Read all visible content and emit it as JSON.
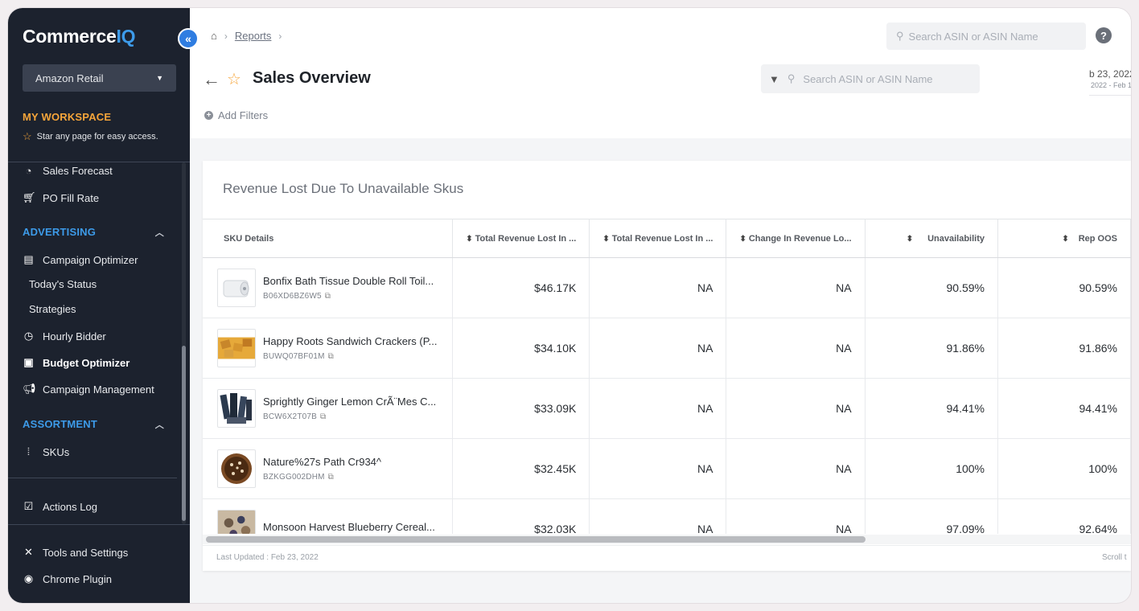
{
  "sidebar": {
    "logo": {
      "part1": "Commerce",
      "part2": "IQ"
    },
    "collapse_icon": "double-chevron-left-icon",
    "retailer": "Amazon Retail",
    "workspace": {
      "title": "MY WORKSPACE",
      "hint": "Star any page for easy access."
    },
    "items_top": [
      {
        "label": "Sales Forecast",
        "icon": "forecast-icon"
      },
      {
        "label": "PO Fill Rate",
        "icon": "cart-icon"
      }
    ],
    "advertising": {
      "title": "ADVERTISING",
      "items": [
        {
          "label": "Campaign Optimizer"
        },
        {
          "label": "Today's Status"
        },
        {
          "label": "Strategies"
        },
        {
          "label": "Hourly Bidder"
        },
        {
          "label": "Budget Optimizer"
        },
        {
          "label": "Campaign Management"
        }
      ]
    },
    "assortment": {
      "title": "ASSORTMENT",
      "items": [
        {
          "label": "SKUs"
        }
      ]
    },
    "actions_log": "Actions Log",
    "tools": "Tools and Settings",
    "chrome": "Chrome Plugin"
  },
  "header": {
    "breadcrumb": {
      "current": "Reports"
    },
    "top_search_placeholder": "Search ASIN or ASIN Name",
    "help": "?",
    "title": "Sales Overview",
    "filter_search_placeholder": "Search ASIN or ASIN Name",
    "date_range": {
      "line1": "b 23, 2022",
      "line2": "2022 - Feb 1"
    },
    "add_filters": "Add Filters"
  },
  "card": {
    "title": "Revenue Lost Due To Unavailable Skus",
    "columns": [
      "SKU Details",
      "Total Revenue Lost In ...",
      "Total Revenue Lost In ...",
      "Change In Revenue Lo...",
      "Unavailability",
      "Rep OOS"
    ],
    "rows": [
      {
        "name": "Bonfix Bath Tissue Double Roll Toil...",
        "id": "B06XD6BZ6W5",
        "c1": "$46.17K",
        "c2": "NA",
        "c3": "NA",
        "c4": "90.59%",
        "c5": "90.59%"
      },
      {
        "name": "Happy Roots Sandwich Crackers (P...",
        "id": "BUWQ07BF01M",
        "c1": "$34.10K",
        "c2": "NA",
        "c3": "NA",
        "c4": "91.86%",
        "c5": "91.86%"
      },
      {
        "name": "Sprightly Ginger Lemon CrÃ¨Mes C...",
        "id": "BCW6X2T07B",
        "c1": "$33.09K",
        "c2": "NA",
        "c3": "NA",
        "c4": "94.41%",
        "c5": "94.41%"
      },
      {
        "name": "Nature%27s Path Cr934^",
        "id": "BZKGG002DHM",
        "c1": "$32.45K",
        "c2": "NA",
        "c3": "NA",
        "c4": "100%",
        "c5": "100%"
      },
      {
        "name": "Monsoon Harvest Blueberry Cereal...",
        "id": "",
        "c1": "$32.03K",
        "c2": "NA",
        "c3": "NA",
        "c4": "97.09%",
        "c5": "92.64%"
      }
    ],
    "last_updated": "Last Updated : Feb 23, 2022",
    "scroll_hint": "Scroll t"
  }
}
